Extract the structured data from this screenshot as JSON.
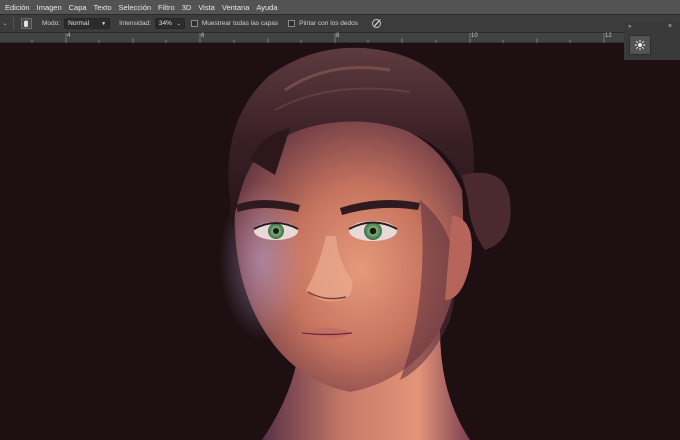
{
  "menu": [
    "Edición",
    "Imagen",
    "Capa",
    "Texto",
    "Selección",
    "Filtro",
    "3D",
    "Vista",
    "Ventana",
    "Ayuda"
  ],
  "options": {
    "mode_label": "Modo:",
    "mode_value": "Normal",
    "intensity_label": "Intensidad:",
    "intensity_value": "34%",
    "sample_all_layers": "Muestrear todas las capas",
    "finger_painting": "Pintar con los dedos"
  },
  "ruler": {
    "labels": [
      "4",
      "6",
      "8",
      "10",
      "12",
      "13"
    ]
  },
  "panel": {
    "collapse": "»",
    "close": "×"
  },
  "icons": {
    "smudge_tool": "smudge-finger-icon",
    "pressure": "pressure-pen-icon",
    "panel_tool": "brush-settings-icon"
  },
  "colors": {
    "menu_bg": "#535353",
    "optbar_bg": "#3c3c3c",
    "canvas_bg": "#1e1012"
  }
}
